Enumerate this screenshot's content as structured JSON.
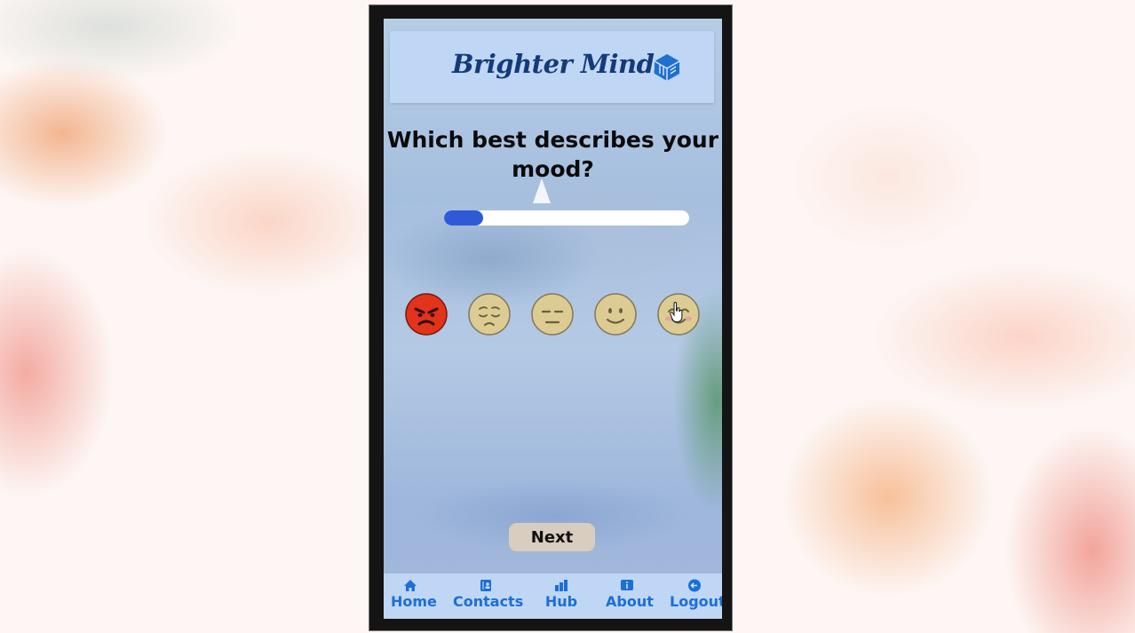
{
  "header": {
    "title": "Brighter Minds",
    "logo_icon": "cube-logo-icon"
  },
  "question": "Which best describes your mood?",
  "progress": {
    "fraction": 0.16,
    "color": "#2f5ad6"
  },
  "moods": [
    {
      "name": "angry",
      "icon": "angry-face-icon",
      "selected": true
    },
    {
      "name": "sad",
      "icon": "sad-face-icon",
      "selected": false
    },
    {
      "name": "neutral",
      "icon": "neutral-face-icon",
      "selected": false
    },
    {
      "name": "content",
      "icon": "smile-face-icon",
      "selected": false
    },
    {
      "name": "happy",
      "icon": "happy-face-icon",
      "selected": false
    }
  ],
  "next_label": "Next",
  "nav": {
    "home": "Home",
    "contacts": "Contacts",
    "hub": "Hub",
    "about": "About",
    "logout": "Logout"
  },
  "colors": {
    "accent": "#1c6fd4",
    "header_bg": "#bfd6f4",
    "title": "#143a78"
  }
}
